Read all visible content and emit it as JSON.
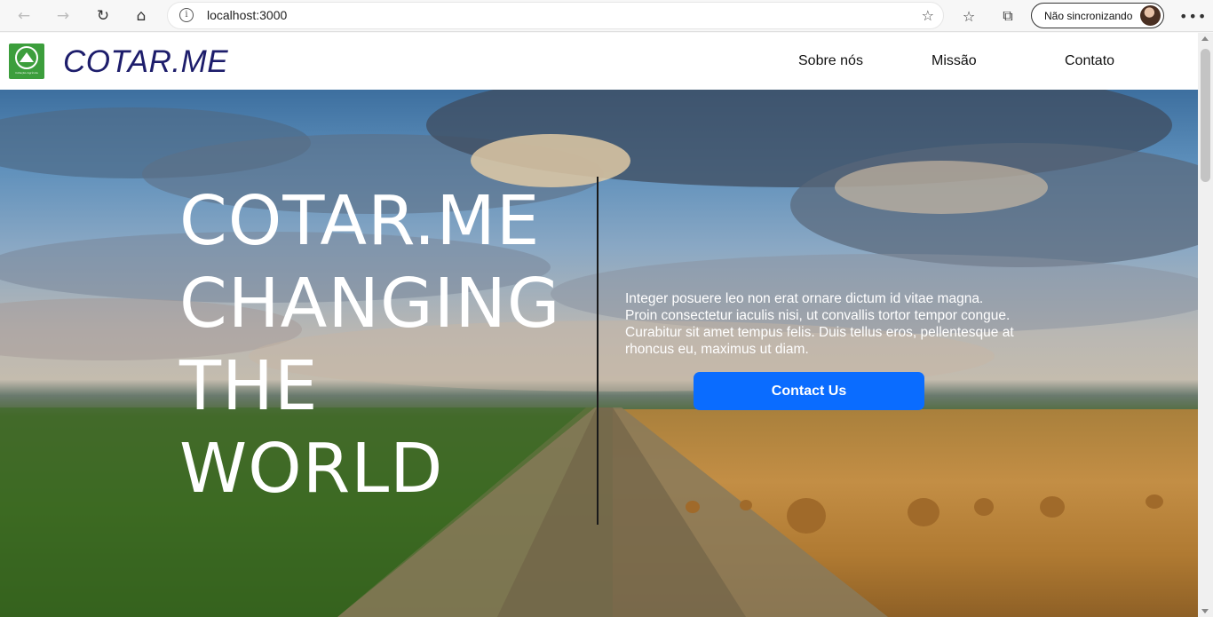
{
  "browser": {
    "url": "localhost:3000",
    "sync_label": "Não sincronizando"
  },
  "site": {
    "brand": "COTAR.ME",
    "logo_caption": "Cotação Agrícola",
    "nav": [
      "Sobre nós",
      "Missão",
      "Contato"
    ]
  },
  "hero": {
    "title_lines": [
      "COTAR.ME",
      "CHANGING",
      "THE",
      "WORLD"
    ],
    "paragraph": "Integer posuere leo non erat ornare dictum id vitae magna. Proin consectetur iaculis nisi, ut convallis tortor tempor congue. Curabitur sit amet tempus felis. Duis tellus eros, pellentesque at rhoncus eu, maximus ut diam.",
    "cta_label": "Contact Us"
  },
  "icons": {
    "back": "arrow-left-icon",
    "forward": "arrow-right-icon",
    "reload": "reload-icon",
    "home": "home-icon",
    "site_info": "info-icon",
    "favorite_add": "star-plus-icon",
    "favorites": "favorites-icon",
    "collections": "collections-icon",
    "menu": "more-icon"
  },
  "colors": {
    "brand_text": "#1d1d6b",
    "cta": "#0a6cff",
    "logo_bg": "#3c9e3c"
  }
}
